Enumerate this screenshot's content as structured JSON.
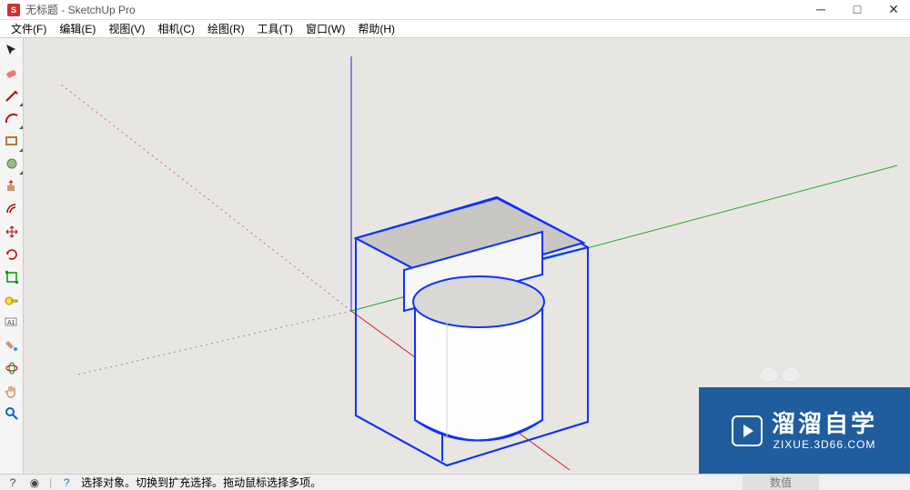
{
  "window": {
    "title": "无标题 - SketchUp Pro"
  },
  "menu": {
    "file": "文件(F)",
    "edit": "编辑(E)",
    "view": "视图(V)",
    "camera": "相机(C)",
    "draw": "绘图(R)",
    "tools": "工具(T)",
    "window": "窗口(W)",
    "help": "帮助(H)"
  },
  "status": {
    "text": "选择对象。切换到扩充选择。拖动鼠标选择多项。",
    "measure_label": "数值"
  },
  "watermark": {
    "brand": "溜溜自学",
    "url": "ZIXUE.3D66.COM"
  },
  "icons": {
    "select": "select-icon",
    "eraser": "eraser-icon",
    "line": "line-icon",
    "arc": "arc-icon",
    "shape": "rectangle-icon",
    "circle": "circle-icon",
    "pushpull": "pushpull-icon",
    "offset": "offset-icon",
    "move": "move-icon",
    "rotate": "rotate-icon",
    "scale": "scale-icon",
    "tape": "tape-icon",
    "text": "text-icon",
    "paint": "paint-icon",
    "orbit": "orbit-icon",
    "pan": "pan-icon",
    "zoom": "zoom-icon"
  }
}
